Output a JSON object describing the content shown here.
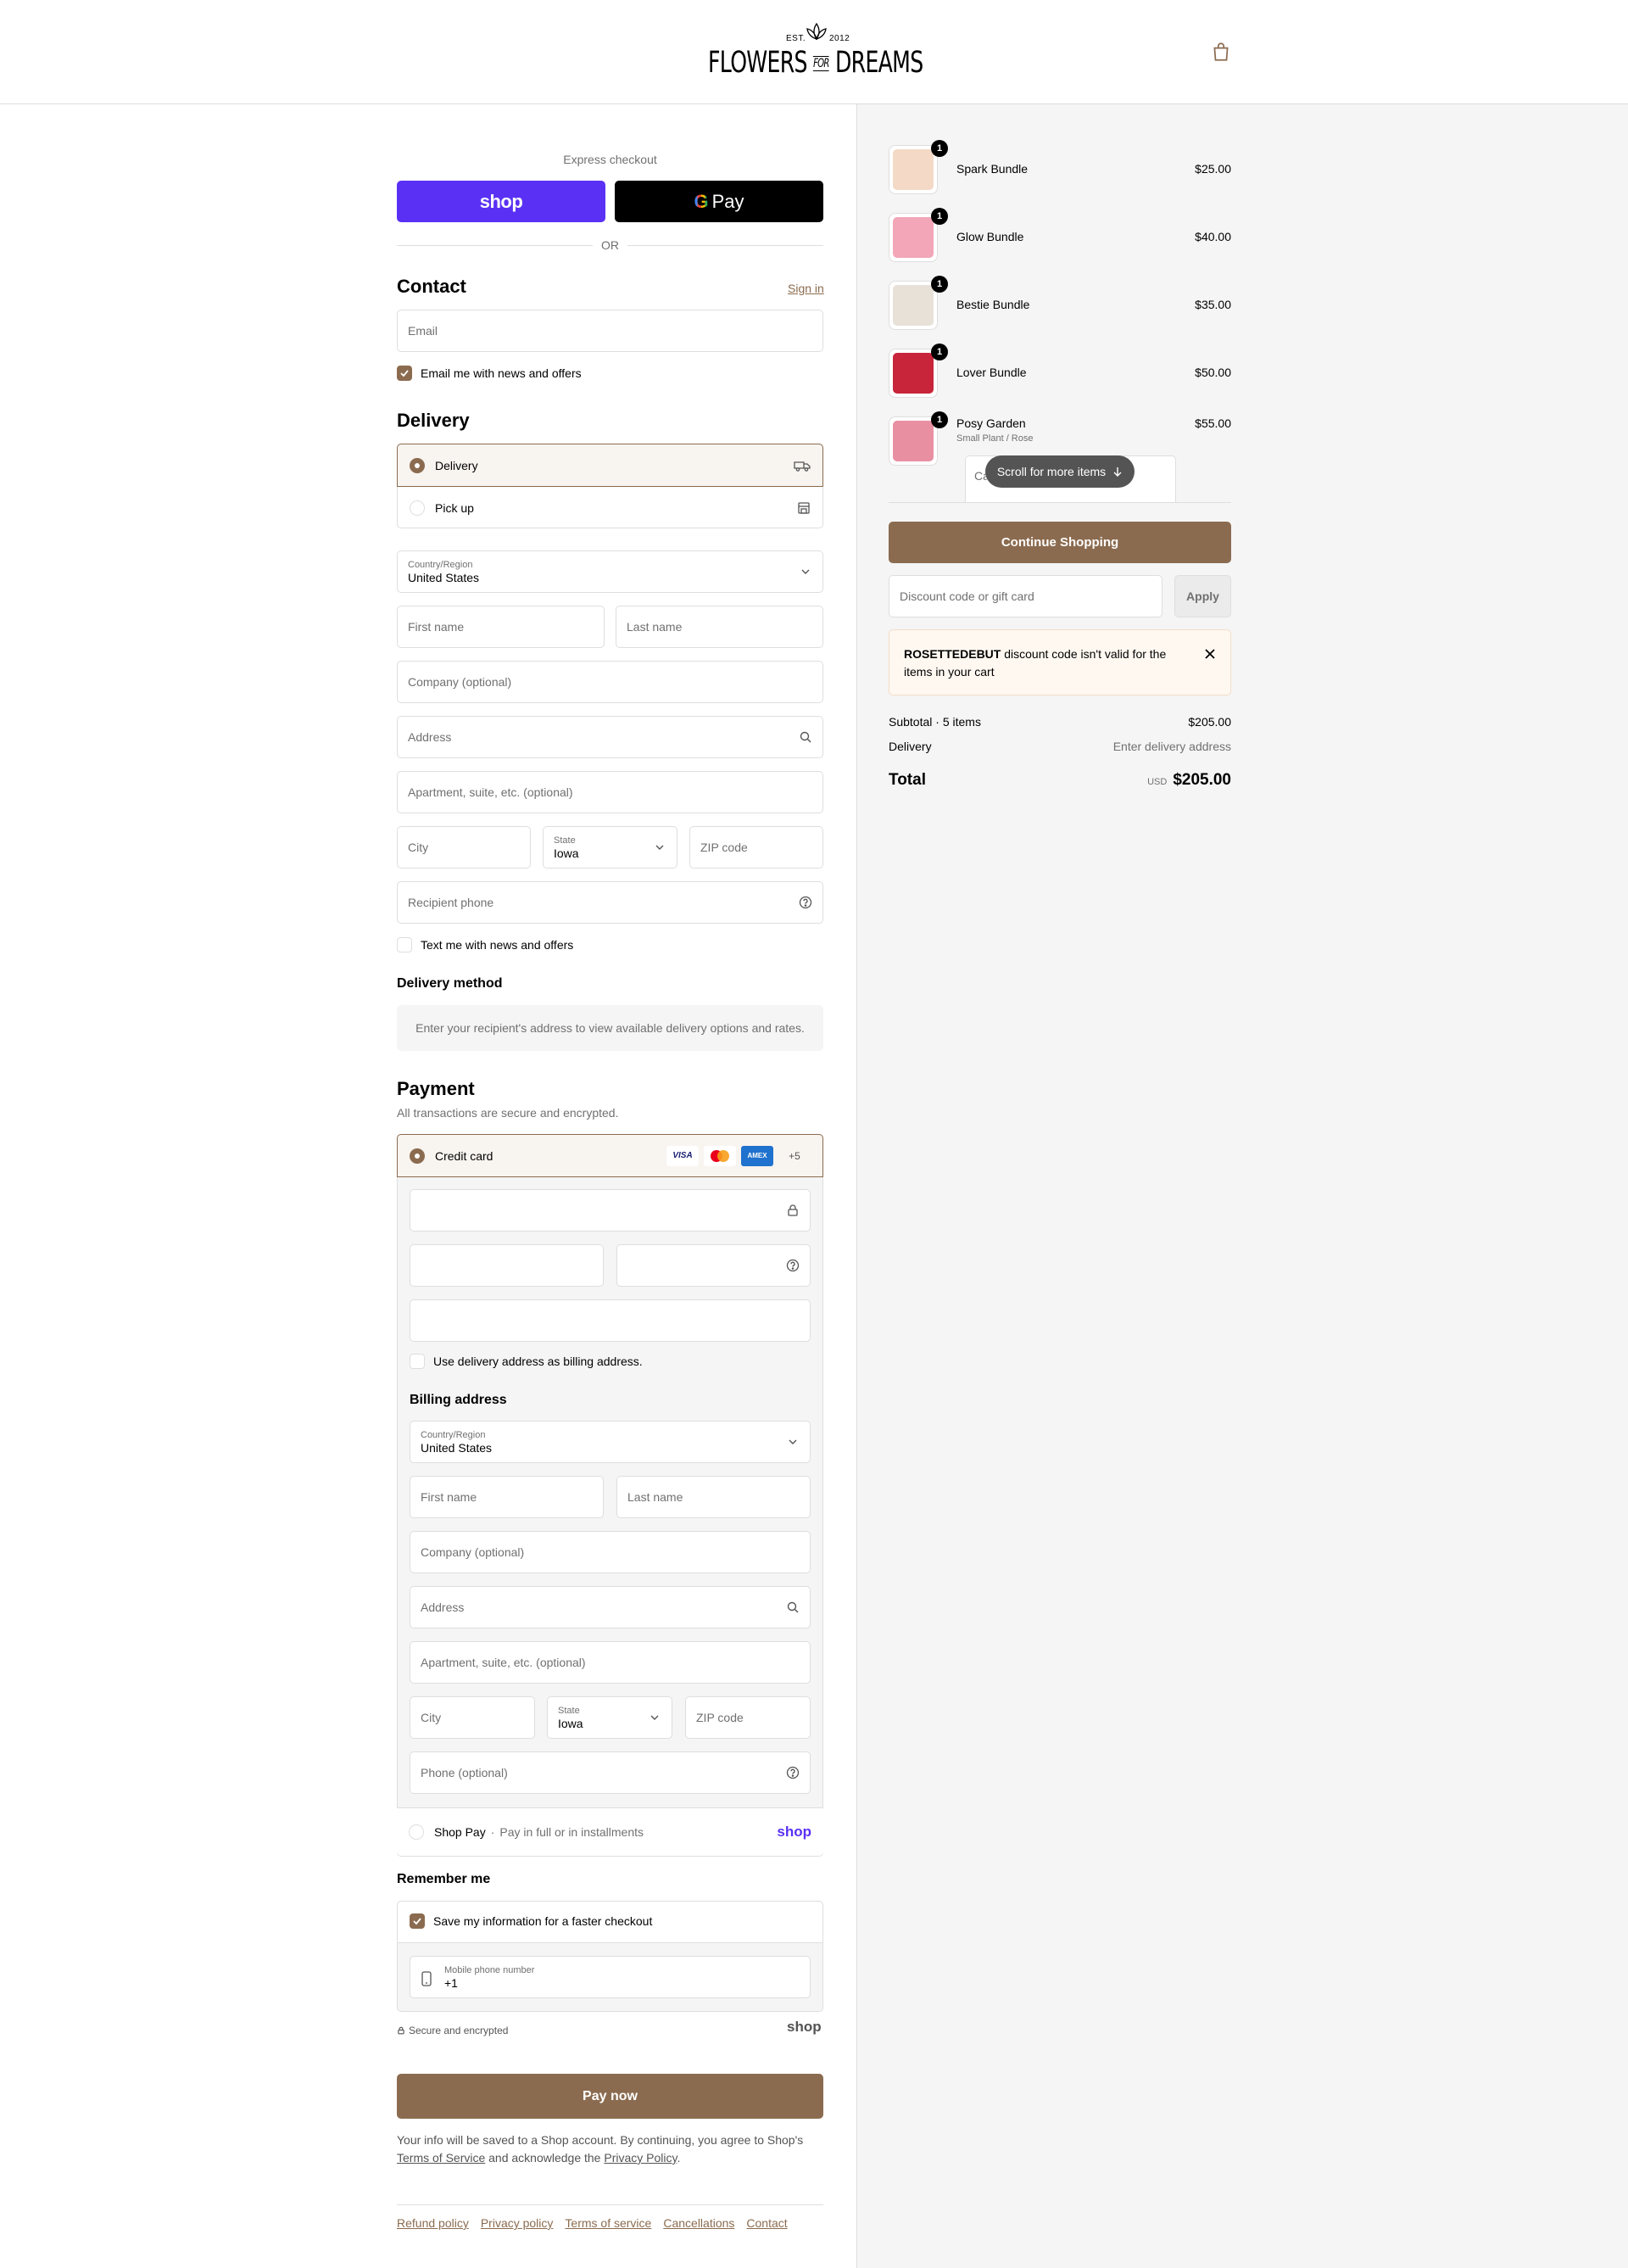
{
  "header": {
    "logo_est": "EST.",
    "logo_year": "2012",
    "logo_word_a": "FLOWERS",
    "logo_word_b": "FOR",
    "logo_word_c": "DREAMS",
    "cart_icon": "shopping-bag-icon"
  },
  "express": {
    "label": "Express checkout",
    "shop_label": "shop",
    "gpay_label": "Pay",
    "or": "OR"
  },
  "contact": {
    "title": "Contact",
    "sign_in": "Sign in",
    "email_placeholder": "Email",
    "news_label": "Email me with news and offers",
    "news_checked": true
  },
  "delivery": {
    "title": "Delivery",
    "options": [
      {
        "label": "Delivery",
        "selected": true,
        "icon": "truck-icon"
      },
      {
        "label": "Pick up",
        "selected": false,
        "icon": "store-icon"
      }
    ],
    "country_label": "Country/Region",
    "country_value": "United States",
    "first_name": "First name",
    "last_name": "Last name",
    "company": "Company (optional)",
    "address": "Address",
    "apartment": "Apartment, suite, etc. (optional)",
    "city": "City",
    "state_label": "State",
    "state_value": "Iowa",
    "zip": "ZIP code",
    "phone": "Recipient phone",
    "text_label": "Text me with news and offers",
    "method_title": "Delivery method",
    "method_info": "Enter your recipient's address to view available delivery options and rates."
  },
  "payment": {
    "title": "Payment",
    "subtitle": "All transactions are secure and encrypted.",
    "credit_card_label": "Credit card",
    "card_badges": [
      "VISA",
      "",
      "AMEX",
      "+5"
    ],
    "billing_same_label": "Use delivery address as billing address.",
    "billing_title": "Billing address",
    "billing": {
      "country_label": "Country/Region",
      "country_value": "United States",
      "first_name": "First name",
      "last_name": "Last name",
      "company": "Company (optional)",
      "address": "Address",
      "apartment": "Apartment, suite, etc. (optional)",
      "city": "City",
      "state_label": "State",
      "state_value": "Iowa",
      "zip": "ZIP code",
      "phone": "Phone (optional)"
    },
    "shop_pay_label": "Shop Pay",
    "shop_pay_sub": "Pay in full or in installments",
    "shop_pay_logo": "shop"
  },
  "remember": {
    "title": "Remember me",
    "save_label": "Save my information for a faster checkout",
    "save_checked": true,
    "mobile_label": "Mobile phone number",
    "mobile_value": "+1",
    "secure_label": "Secure and encrypted",
    "shop_logo": "shop"
  },
  "pay_now": "Pay now",
  "legal": {
    "text_a": "Your info will be saved to a Shop account. By continuing, you agree to Shop's",
    "tos": "Terms of Service",
    "text_b": "and acknowledge the",
    "privacy": "Privacy Policy",
    "text_c": "."
  },
  "footer": [
    "Refund policy",
    "Privacy policy",
    "Terms of service",
    "Cancellations",
    "Contact"
  ],
  "cart": {
    "items": [
      {
        "name": "Spark Bundle",
        "price": "$25.00",
        "qty": "1",
        "color": "#f3d9c6"
      },
      {
        "name": "Glow Bundle",
        "price": "$40.00",
        "qty": "1",
        "color": "#f2a6b8"
      },
      {
        "name": "Bestie Bundle",
        "price": "$35.00",
        "qty": "1",
        "color": "#e8e1d8"
      },
      {
        "name": "Lover Bundle",
        "price": "$50.00",
        "qty": "1",
        "color": "#c8243a"
      },
      {
        "name": "Posy Garden",
        "price": "$55.00",
        "qty": "1",
        "variant": "Small Plant / Rose",
        "color": "#e98fa2"
      }
    ],
    "scroll_hint": "Scroll for more items",
    "scroll_hint_partial": "Ca",
    "continue_shopping": "Continue Shopping",
    "discount_placeholder": "Discount code or gift card",
    "apply": "Apply",
    "error_code": "ROSETTEDEBUT",
    "error_text": "discount code isn't valid for the items in your cart",
    "subtotal_label": "Subtotal · 5 items",
    "subtotal_value": "$205.00",
    "delivery_label": "Delivery",
    "delivery_value": "Enter delivery address",
    "total_label": "Total",
    "total_currency": "USD",
    "total_value": "$205.00"
  },
  "colors": {
    "brand": "#8b6b4f",
    "shop_purple": "#5a31f4",
    "error_bg": "#fff8f1"
  }
}
